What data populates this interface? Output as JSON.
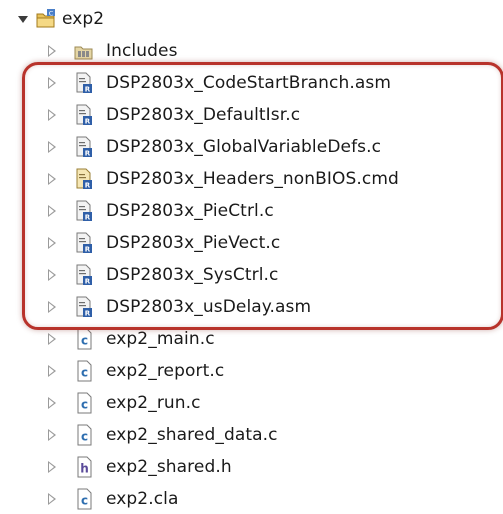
{
  "tree": {
    "project": {
      "label": "exp2",
      "icon": "project-folder-icon",
      "expanded": true
    },
    "items": [
      {
        "label": "Includes",
        "icon": "includes-folder-icon"
      },
      {
        "label": "DSP2803x_CodeStartBranch.asm",
        "icon": "linked-source-file-icon"
      },
      {
        "label": "DSP2803x_DefaultIsr.c",
        "icon": "linked-source-file-icon"
      },
      {
        "label": "DSP2803x_GlobalVariableDefs.c",
        "icon": "linked-source-file-icon"
      },
      {
        "label": "DSP2803x_Headers_nonBIOS.cmd",
        "icon": "linked-cmd-file-icon"
      },
      {
        "label": "DSP2803x_PieCtrl.c",
        "icon": "linked-source-file-icon"
      },
      {
        "label": "DSP2803x_PieVect.c",
        "icon": "linked-source-file-icon"
      },
      {
        "label": "DSP2803x_SysCtrl.c",
        "icon": "linked-source-file-icon"
      },
      {
        "label": "DSP2803x_usDelay.asm",
        "icon": "linked-source-file-icon"
      },
      {
        "label": "exp2_main.c",
        "icon": "c-file-icon"
      },
      {
        "label": "exp2_report.c",
        "icon": "c-file-icon"
      },
      {
        "label": "exp2_run.c",
        "icon": "c-file-icon"
      },
      {
        "label": "exp2_shared_data.c",
        "icon": "c-file-icon"
      },
      {
        "label": "exp2_shared.h",
        "icon": "h-file-icon"
      },
      {
        "label": "exp2.cla",
        "icon": "c-file-icon"
      }
    ]
  },
  "colors": {
    "highlight": "#b8332b",
    "c_icon": "#2f6fb0",
    "h_icon": "#5a4a9a"
  }
}
